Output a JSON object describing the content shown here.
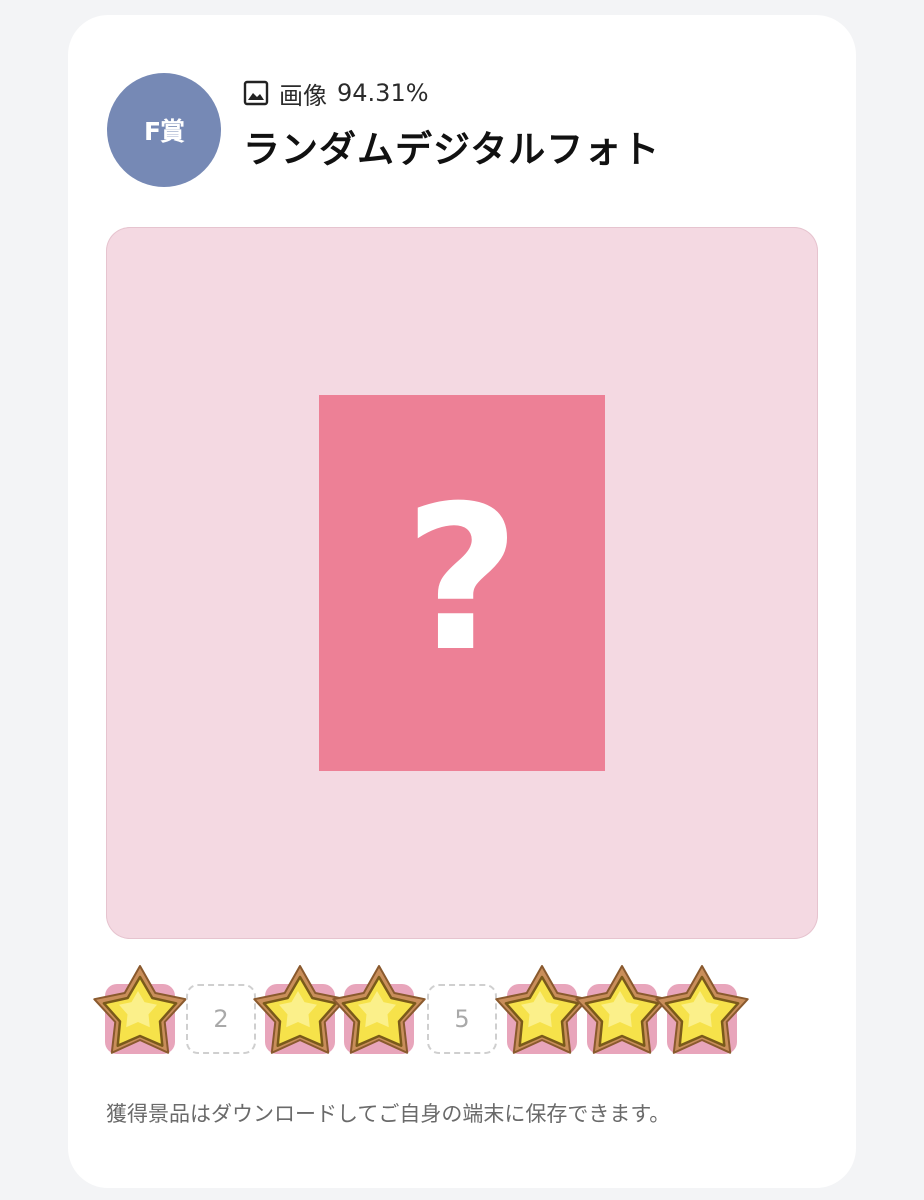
{
  "prize": {
    "badge": "F賞",
    "type_label": "画像",
    "rate": "94.31%",
    "title": "ランダムデジタルフォト",
    "placeholder_symbol": "?"
  },
  "stamps": [
    {
      "index": 1,
      "label": "",
      "collected": true
    },
    {
      "index": 2,
      "label": "2",
      "collected": false
    },
    {
      "index": 3,
      "label": "",
      "collected": true
    },
    {
      "index": 4,
      "label": "",
      "collected": true
    },
    {
      "index": 5,
      "label": "5",
      "collected": false
    },
    {
      "index": 6,
      "label": "",
      "collected": true
    },
    {
      "index": 7,
      "label": "",
      "collected": true
    },
    {
      "index": 8,
      "label": "",
      "collected": true
    }
  ],
  "note": "獲得景品はダウンロードしてご自身の端末に保存できます。",
  "colors": {
    "badge": "#7689b5",
    "preview_bg": "#f4d9e2",
    "mystery_card": "#ed8096",
    "star_fill": "#f6e24a",
    "star_frame": "#c98e5a"
  },
  "icons": {
    "type_icon": "image-icon",
    "stamp_icon": "star-icon"
  }
}
